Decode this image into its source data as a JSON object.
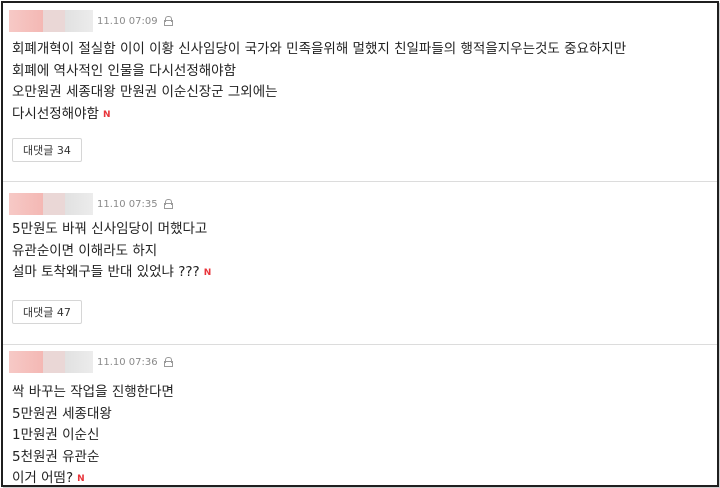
{
  "comments": [
    {
      "time": "11.10 07:09",
      "lines": [
        "회폐개혁이 절실함 이이 이황 신사임당이 국가와 민족을위해 멀했지 친일파들의 행적을지우는것도 중요하지만",
        "회폐에 역사적인 인물을 다시선정해야함",
        "오만원권 세종대왕 만원권 이순신장군 그외에는",
        "다시선정해야함"
      ],
      "new_badge": "N",
      "reply_label": "대댓글 34"
    },
    {
      "time": "11.10 07:35",
      "lines": [
        "5만원도 바꿔 신사임당이 머했다고",
        "유관순이면 이해라도 하지",
        "설마 토착왜구들 반대 있었냐 ???"
      ],
      "new_badge": "N",
      "reply_label": "대댓글 47"
    },
    {
      "time": "11.10 07:36",
      "lines": [
        "싹 바꾸는 작업을 진행한다면",
        "5만원권 세종대왕",
        "1만원권 이순신",
        "5천원권 유관순",
        "이거 어떰?"
      ],
      "new_badge": "N"
    }
  ],
  "icons": {
    "lock": "lock-icon"
  },
  "colors": {
    "new_badge": "#e8343a",
    "border": "#1f1f1f",
    "divider": "#dcdcdc"
  }
}
